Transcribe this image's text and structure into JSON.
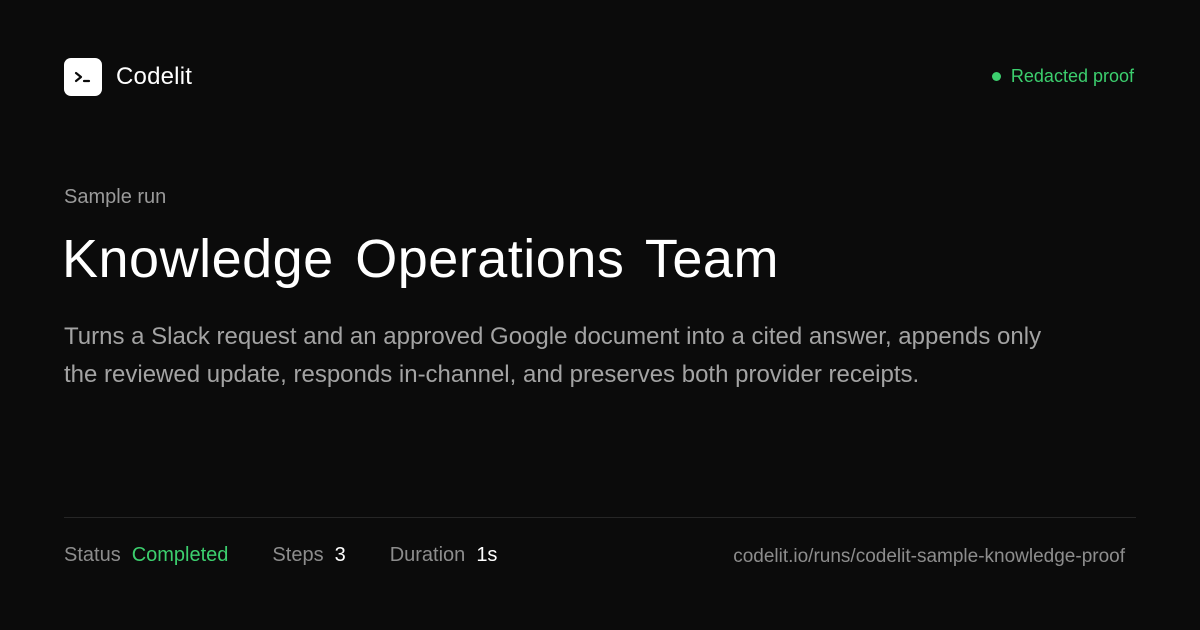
{
  "header": {
    "brand_name": "Codelit",
    "logo_icon": "terminal-prompt-icon",
    "proof_label": "Redacted proof",
    "proof_color": "#3ccf6e"
  },
  "main": {
    "eyebrow": "Sample run",
    "title": "Knowledge Operations Team",
    "description": "Turns a Slack request and an approved Google document into a cited answer, appends only the reviewed update, responds in-channel, and preserves both provider receipts."
  },
  "footer": {
    "status_label": "Status",
    "status_value": "Completed",
    "steps_label": "Steps",
    "steps_value": "3",
    "duration_label": "Duration",
    "duration_value": "1s",
    "url": "codelit.io/runs/codelit-sample-knowledge-proof"
  },
  "colors": {
    "background": "#0b0b0b",
    "accent_green": "#3ccf6e",
    "text_primary": "#ffffff",
    "text_muted": "#9a9a9a"
  }
}
